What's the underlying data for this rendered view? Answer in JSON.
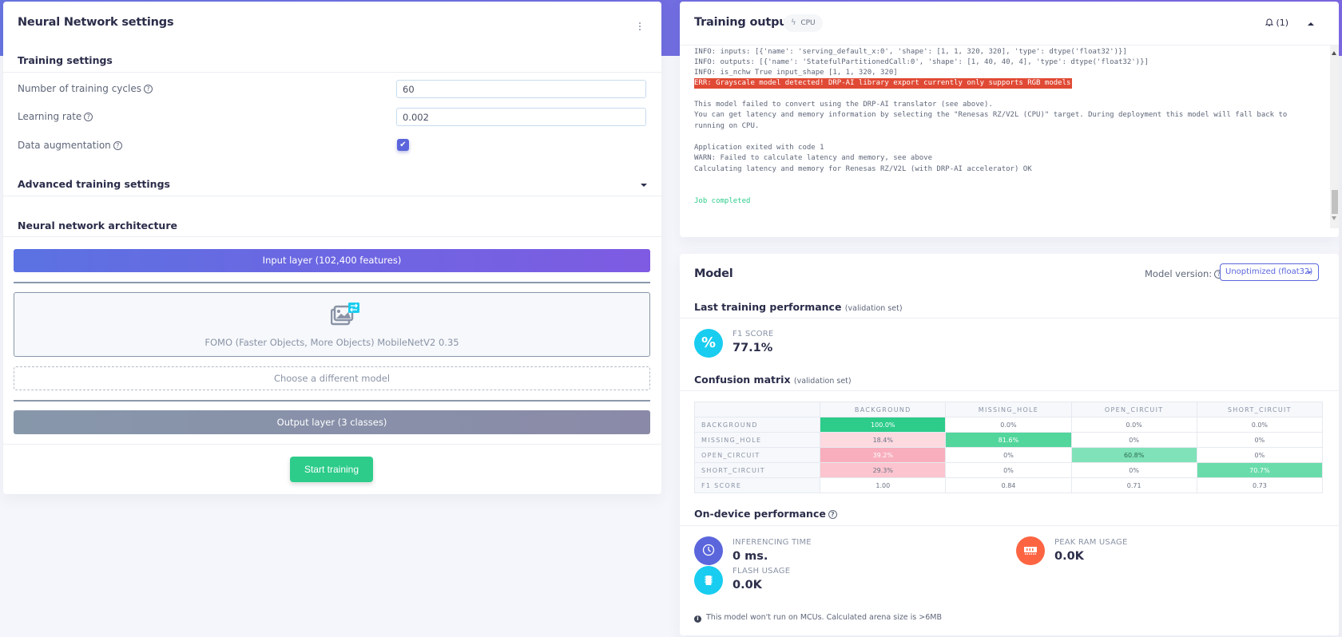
{
  "nn_settings": {
    "title": "Neural Network settings",
    "training_settings_title": "Training settings",
    "fields": [
      {
        "label": "Number of training cycles",
        "value": "60"
      },
      {
        "label": "Learning rate",
        "value": "0.002"
      },
      {
        "label": "Data augmentation",
        "checked": true
      }
    ],
    "advanced_title": "Advanced training settings",
    "architecture_title": "Neural network architecture",
    "input_layer": "Input layer (102,400 features)",
    "model_name": "FOMO (Faster Objects, More Objects) MobileNetV2 0.35",
    "choose_model": "Choose a different model",
    "output_layer": "Output layer (3 classes)",
    "start_training": "Start training",
    "help_glyph": "?"
  },
  "training_output": {
    "title": "Training output",
    "badge": "CPU",
    "notifications": "(1)",
    "log": [
      {
        "text": "INFO: inputs: [{'name': 'serving_default_x:0', 'shape': [1, 1, 320, 320], 'type': dtype('float32')}]",
        "type": "info"
      },
      {
        "text": "INFO: outputs: [{'name': 'StatefulPartitionedCall:0', 'shape': [1, 40, 40, 4], 'type': dtype('float32')}]",
        "type": "info"
      },
      {
        "text": "INFO: is_nchw True input_shape [1, 1, 320, 320]",
        "type": "info"
      },
      {
        "text": "ERR: Grayscale model detected! DRP-AI library export currently only supports RGB models",
        "type": "error"
      },
      {
        "text": "This model failed to convert using the DRP-AI translator (see above).",
        "type": "info"
      },
      {
        "text": "You can get latency and memory information by selecting the \"Renesas RZ/V2L (CPU)\" target. During deployment this model will fall back to",
        "type": "info"
      },
      {
        "text": "running on CPU.",
        "type": "info"
      },
      {
        "text": "Application exited with code 1",
        "type": "info"
      },
      {
        "text": "WARN: Failed to calculate latency and memory, see above",
        "type": "info"
      },
      {
        "text": "Calculating latency and memory for Renesas RZ/V2L (with DRP-AI accelerator) OK",
        "type": "info"
      },
      {
        "text": "Job completed",
        "type": "success"
      }
    ]
  },
  "model": {
    "title": "Model",
    "version_label": "Model version:",
    "version_value": "Unoptimized (float32)",
    "last_perf_title": "Last training performance",
    "validation_set": "(validation set)",
    "f1_label": "F1 SCORE",
    "f1_value": "77.1%",
    "f1_icon": "%",
    "confusion_title": "Confusion matrix",
    "confusion_matrix": {
      "columns": [
        "BACKGROUND",
        "MISSING_HOLE",
        "OPEN_CIRCUIT",
        "SHORT_CIRCUIT"
      ],
      "rows": [
        {
          "label": "BACKGROUND",
          "cells": [
            "100.0%",
            "0.0%",
            "0.0%",
            "0.0%"
          ]
        },
        {
          "label": "MISSING_HOLE",
          "cells": [
            "18.4%",
            "81.6%",
            "0%",
            "0%"
          ]
        },
        {
          "label": "OPEN_CIRCUIT",
          "cells": [
            "39.2%",
            "0%",
            "60.8%",
            "0%"
          ]
        },
        {
          "label": "SHORT_CIRCUIT",
          "cells": [
            "29.3%",
            "0%",
            "0%",
            "70.7%"
          ]
        },
        {
          "label": "F1 SCORE",
          "cells": [
            "1.00",
            "0.84",
            "0.71",
            "0.73"
          ]
        }
      ]
    },
    "on_device_title": "On-device performance",
    "inferencing_label": "INFERENCING TIME",
    "inferencing_value": "0 ms.",
    "ram_label": "PEAK RAM USAGE",
    "ram_value": "0.0K",
    "flash_label": "FLASH USAGE",
    "flash_value": "0.0K",
    "note": "This model won't run on MCUs. Calculated arena size is >6MB",
    "colors": {
      "accent": "#5b66dc",
      "success": "#2dcc8a",
      "error": "#e04a35",
      "cyan": "#18cdf0",
      "orange": "#fd6542"
    }
  }
}
